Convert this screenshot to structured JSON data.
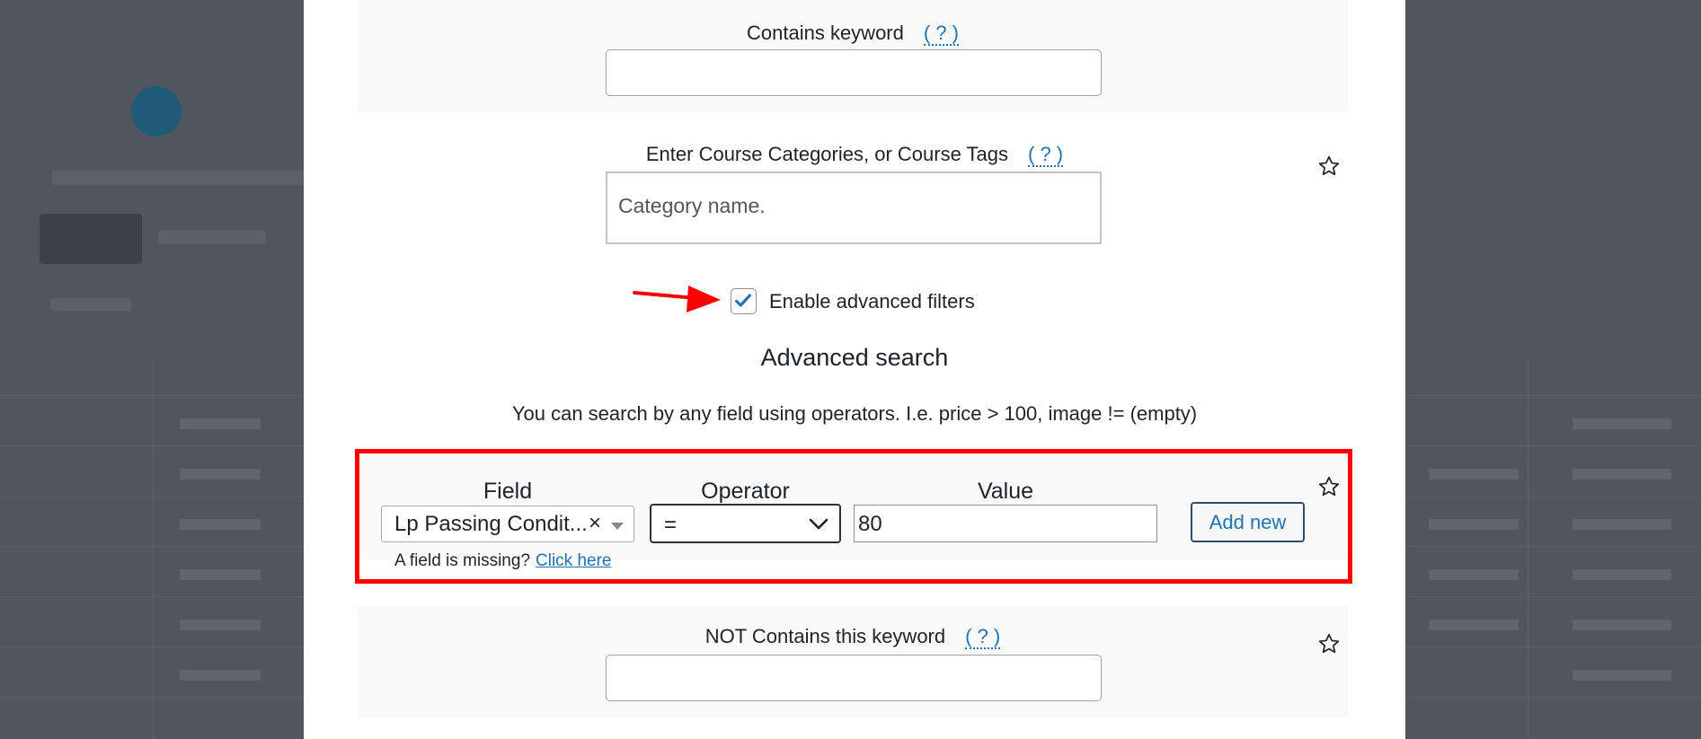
{
  "keyword_filter": {
    "label": "Contains keyword",
    "help": "( ? )",
    "value": ""
  },
  "taxonomy_filter": {
    "label": "Enter Course Categories, or Course Tags",
    "help": "( ? )",
    "placeholder": "Category name."
  },
  "advanced_toggle": {
    "label": "Enable advanced filters",
    "checked": true
  },
  "advanced_search": {
    "title": "Advanced search",
    "description": "You can search by any field using operators. I.e. price > 100, image != (empty)",
    "headers": {
      "field": "Field",
      "operator": "Operator",
      "value": "Value"
    },
    "field_value": "Lp Passing Condit...",
    "clear_symbol": "×",
    "operator_value": "=",
    "value": "80",
    "add_new_label": "Add new",
    "missing_text": "A field is missing?",
    "missing_link": "Click here"
  },
  "not_keyword_filter": {
    "label": "NOT Contains this keyword",
    "help": "( ? )",
    "value": ""
  },
  "icons": {
    "favorite": "star-outline-icon",
    "dropdown": "chevron-down-icon",
    "pointer": "red-arrow-icon"
  },
  "colors": {
    "highlight": "#ff0000",
    "link": "#2271b1",
    "check": "#2271b1",
    "overlay": "#50555e"
  }
}
